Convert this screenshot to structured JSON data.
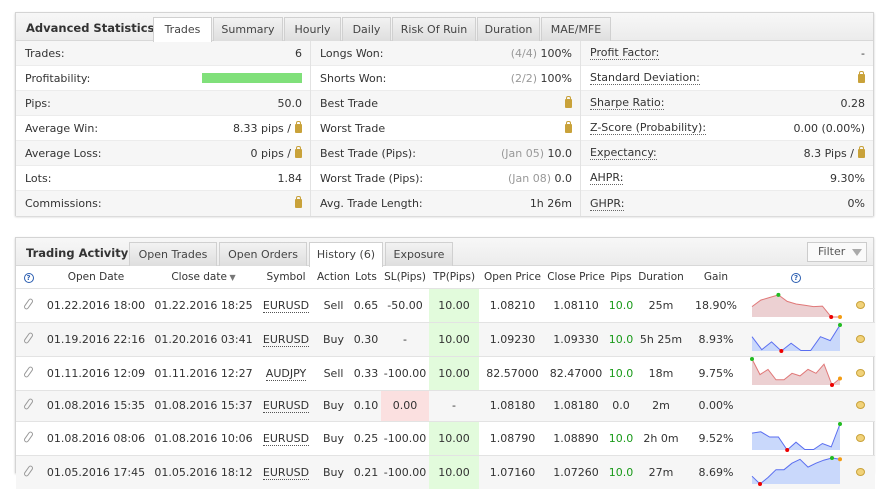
{
  "stats": {
    "title": "Advanced Statistics",
    "tabs": [
      "Trades",
      "Summary",
      "Hourly",
      "Daily",
      "Risk Of Ruin",
      "Duration",
      "MAE/MFE"
    ],
    "active_tab": "Trades",
    "col1": [
      {
        "label": "Trades:",
        "value": "6"
      },
      {
        "label": "Profitability:",
        "progress": 1.0,
        "color": "#80e07a"
      },
      {
        "label": "Pips:",
        "value": "50.0"
      },
      {
        "label": "Average Win:",
        "value": "8.33 pips /",
        "lock": true
      },
      {
        "label": "Average Loss:",
        "value": "0 pips /",
        "lock": true
      },
      {
        "label": "Lots:",
        "value": "1.84"
      },
      {
        "label": "Commissions:",
        "value": "",
        "lock": true
      }
    ],
    "col2": [
      {
        "label": "Longs Won:",
        "muted": "(4/4)",
        "value": "100%"
      },
      {
        "label": "Shorts Won:",
        "muted": "(2/2)",
        "value": "100%"
      },
      {
        "label": "Best Trade",
        "value": "",
        "lock": true
      },
      {
        "label": "Worst Trade",
        "value": "",
        "lock": true
      },
      {
        "label": "Best Trade (Pips):",
        "muted": "(Jan 05)",
        "value": "10.0"
      },
      {
        "label": "Worst Trade (Pips):",
        "muted": "(Jan 08)",
        "value": "0.0"
      },
      {
        "label": "Avg. Trade Length:",
        "value": "1h 26m"
      }
    ],
    "col3": [
      {
        "label": "Profit Factor:",
        "value": "-"
      },
      {
        "label": "Standard Deviation:",
        "value": "",
        "lock": true
      },
      {
        "label": "Sharpe Ratio:",
        "value": "0.28"
      },
      {
        "label": "Z-Score (Probability):",
        "value": "0.00 (0.00%)"
      },
      {
        "label": "Expectancy:",
        "value": "8.3 Pips /",
        "lock": true
      },
      {
        "label": "AHPR:",
        "value": "9.30%"
      },
      {
        "label": "GHPR:",
        "value": "0%"
      }
    ]
  },
  "activity": {
    "title": "Trading Activity",
    "tabs": [
      "Open Trades",
      "Open Orders",
      "History (6)",
      "Exposure"
    ],
    "active_tab": "History (6)",
    "filter_label": "Filter",
    "columns": [
      "Open Date",
      "Close date",
      "Symbol",
      "Action",
      "Lots",
      "SL(Pips)",
      "TP(Pips)",
      "Open Price",
      "Close Price",
      "Pips",
      "Duration",
      "Gain"
    ],
    "help_icon": "?",
    "rows": [
      {
        "open": "01.22.2016 18:00",
        "close": "01.22.2016 18:25",
        "symbol": "EURUSD",
        "action": "Sell",
        "lots": "0.65",
        "sl": "-50.00",
        "tp": "10.00",
        "open_price": "1.08210",
        "close_price": "1.08110",
        "pips": "10.0",
        "duration": "25m",
        "gain": "18.90%",
        "spark": {
          "color": "red",
          "values": [
            0.4,
            0.65,
            0.75,
            0.85,
            0.6,
            0.5,
            0.45,
            0.4,
            0.42,
            0,
            0
          ]
        }
      },
      {
        "open": "01.19.2016 22:16",
        "close": "01.20.2016 03:41",
        "symbol": "EURUSD",
        "action": "Buy",
        "lots": "0.30",
        "sl": "-",
        "tp": "10.00",
        "open_price": "1.09230",
        "close_price": "1.09330",
        "pips": "10.0",
        "duration": "5h 25m",
        "gain": "8.93%",
        "spark": {
          "color": "blue",
          "values": [
            0.55,
            0.05,
            0.35,
            0,
            0.3,
            0.02,
            0.02,
            0.55,
            0.4,
            1
          ]
        }
      },
      {
        "open": "01.11.2016 12:09",
        "close": "01.11.2016 12:27",
        "symbol": "AUDJPY",
        "action": "Sell",
        "lots": "0.33",
        "sl": "-100.00",
        "tp": "10.00",
        "open_price": "82.57000",
        "close_price": "82.47000",
        "pips": "10.0",
        "duration": "18m",
        "gain": "9.75%",
        "spark": {
          "color": "red",
          "values": [
            1,
            0.4,
            0.6,
            0.2,
            0.2,
            0.45,
            0.35,
            0.6,
            0.45,
            0.8,
            0,
            0.25
          ]
        }
      },
      {
        "open": "01.08.2016 15:35",
        "close": "01.08.2016 15:37",
        "symbol": "EURUSD",
        "action": "Buy",
        "lots": "0.10",
        "sl": "0.00",
        "sl_red": true,
        "tp": "-",
        "tp_plain": true,
        "open_price": "1.08180",
        "close_price": "1.08180",
        "pips": "0.0",
        "pips_plain": true,
        "duration": "2m",
        "gain": "0.00%",
        "spark": null
      },
      {
        "open": "01.08.2016 08:06",
        "close": "01.08.2016 10:06",
        "symbol": "EURUSD",
        "action": "Buy",
        "lots": "0.25",
        "sl": "-100.00",
        "tp": "10.00",
        "open_price": "1.08790",
        "close_price": "1.08890",
        "pips": "10.0",
        "duration": "2h 0m",
        "gain": "9.52%",
        "spark": {
          "color": "blue",
          "values": [
            0.65,
            0.7,
            0.5,
            0.5,
            0,
            0.3,
            0.02,
            0.02,
            0.25,
            0.12,
            1
          ]
        }
      },
      {
        "open": "01.05.2016 17:45",
        "close": "01.05.2016 18:12",
        "symbol": "EURUSD",
        "action": "Buy",
        "lots": "0.21",
        "sl": "-100.00",
        "tp": "10.00",
        "open_price": "1.07160",
        "close_price": "1.07260",
        "pips": "10.0",
        "duration": "27m",
        "gain": "8.69%",
        "spark": {
          "color": "blue",
          "values": [
            0.3,
            0,
            0.25,
            0.55,
            0.55,
            0.8,
            0.95,
            0.65,
            0.8,
            0.92,
            1,
            0.95
          ]
        }
      }
    ]
  }
}
